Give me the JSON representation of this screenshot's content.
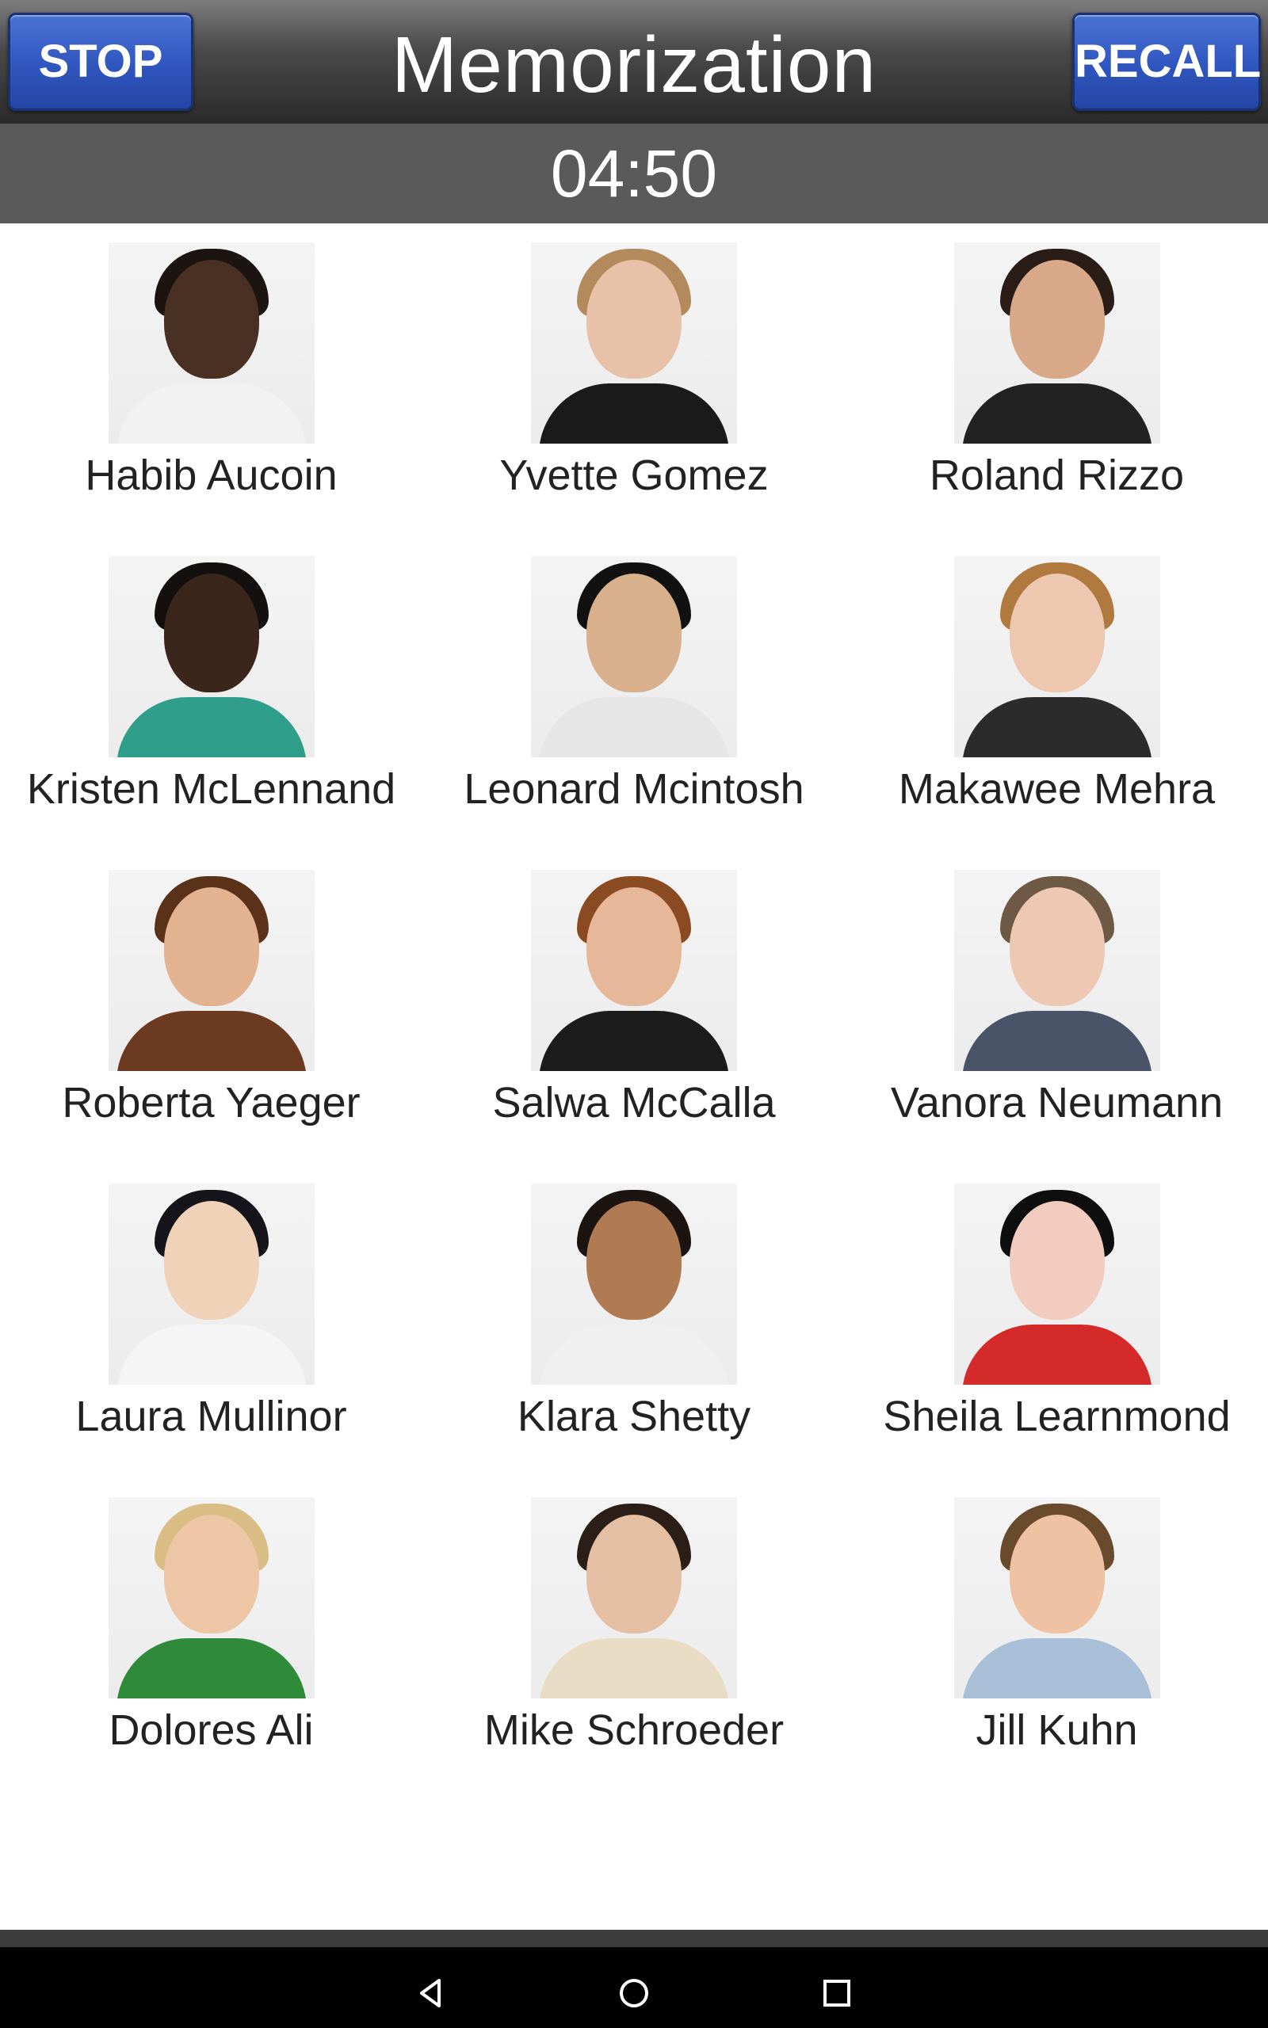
{
  "header": {
    "title": "Memorization",
    "stop_label": "STOP",
    "recall_label": "RECALL",
    "button_color": "#2f56bf"
  },
  "timer": {
    "value": "04:50"
  },
  "people": [
    {
      "name": "Habib Aucoin",
      "skin": "#4a3023",
      "hair": "#1b1410",
      "shirt": "#f2f2f2"
    },
    {
      "name": "Yvette Gomez",
      "skin": "#e8c2a8",
      "hair": "#b38a5c",
      "shirt": "#1a1a1a"
    },
    {
      "name": "Roland Rizzo",
      "skin": "#d8a888",
      "hair": "#2a1d17",
      "shirt": "#222222"
    },
    {
      "name": "Kristen McLennand",
      "skin": "#3b261c",
      "hair": "#141010",
      "shirt": "#2f9e8a"
    },
    {
      "name": "Leonard Mcintosh",
      "skin": "#d9b08c",
      "hair": "#111111",
      "shirt": "#e6e6e6"
    },
    {
      "name": "Makawee Mehra",
      "skin": "#edc7b0",
      "hair": "#b07a3e",
      "shirt": "#2b2b2b"
    },
    {
      "name": "Roberta Yaeger",
      "skin": "#e2b291",
      "hair": "#5a3219",
      "shirt": "#6b3a20"
    },
    {
      "name": "Salwa McCalla",
      "skin": "#e7b79a",
      "hair": "#8a4a22",
      "shirt": "#1c1c1c"
    },
    {
      "name": "Vanora Neumann",
      "skin": "#edc9b3",
      "hair": "#6e5a44",
      "shirt": "#4a5468"
    },
    {
      "name": "Laura Mullinor",
      "skin": "#f0d2b8",
      "hair": "#15141a",
      "shirt": "#f5f5f5"
    },
    {
      "name": "Klara Shetty",
      "skin": "#b07a52",
      "hair": "#1c1410",
      "shirt": "#f0f0f0"
    },
    {
      "name": "Sheila Learnmond",
      "skin": "#f2cdbf",
      "hair": "#0e0e0e",
      "shirt": "#d42a2a"
    },
    {
      "name": "Dolores Ali",
      "skin": "#edc6a6",
      "hair": "#d9bd84",
      "shirt": "#2f8a3a"
    },
    {
      "name": "Mike Schroeder",
      "skin": "#e5bfa3",
      "hair": "#2a1e17",
      "shirt": "#e8dcc4"
    },
    {
      "name": "Jill Kuhn",
      "skin": "#eec2a3",
      "hair": "#6a4a2c",
      "shirt": "#a9bfd8"
    }
  ],
  "navbar": {
    "icons": [
      "back-icon",
      "home-icon",
      "recents-icon"
    ]
  }
}
